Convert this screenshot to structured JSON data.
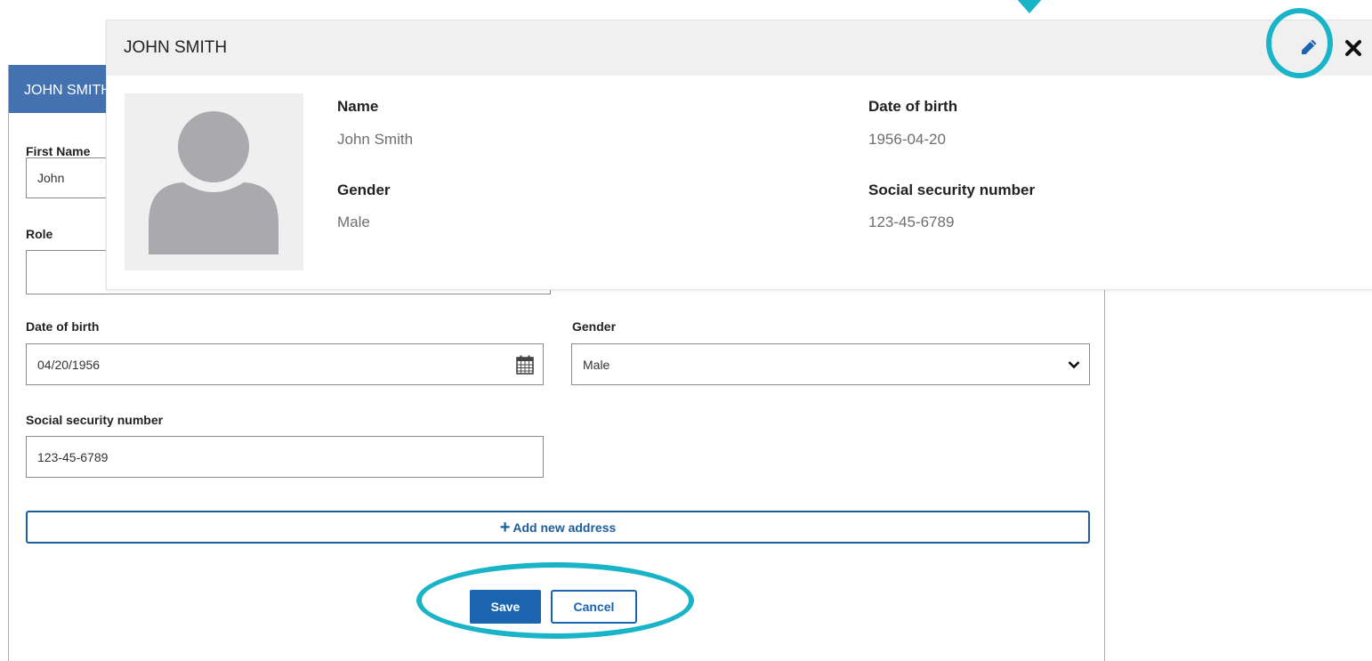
{
  "form": {
    "header_title": "JOHN SMITH",
    "first_name_label": "First Name",
    "first_name_value": "John",
    "role_label": "Role",
    "role_value": "",
    "dob_label": "Date of birth",
    "dob_value": "04/20/1956",
    "gender_label": "Gender",
    "gender_value": "Male",
    "ssn_label": "Social security number",
    "ssn_value": "123-45-6789",
    "add_address_label": "Add new address",
    "save_label": "Save",
    "cancel_label": "Cancel"
  },
  "card": {
    "title": "JOHN SMITH",
    "name_label": "Name",
    "name_value": "John Smith",
    "gender_label": "Gender",
    "gender_value": "Male",
    "dob_label": "Date of birth",
    "dob_value": "1956-04-20",
    "ssn_label": "Social security number",
    "ssn_value": "123-45-6789"
  },
  "icons": {
    "edit": "pencil-icon",
    "close": "close-icon",
    "calendar": "calendar-icon",
    "dropdown": "chevron-down-icon",
    "add": "plus-icon",
    "avatar": "user-placeholder-icon"
  },
  "colors": {
    "header_blue": "#4472b0",
    "primary_button": "#1b64b0",
    "annotation_teal": "#1ab4c8"
  }
}
